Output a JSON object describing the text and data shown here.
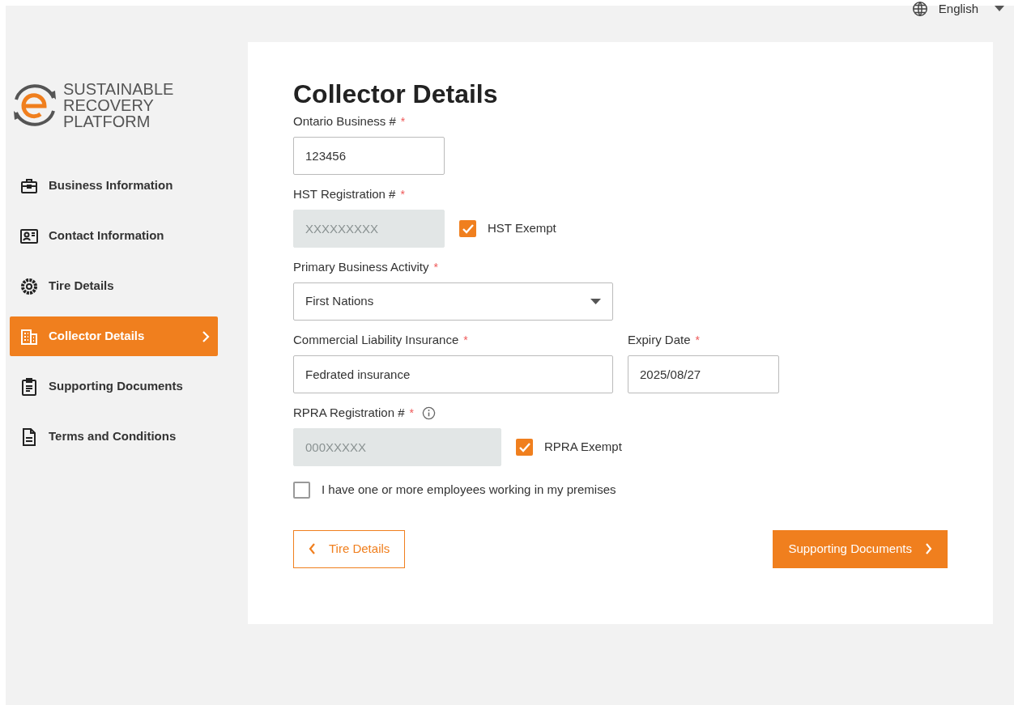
{
  "language": {
    "label": "English"
  },
  "logo": {
    "lines": [
      "SUSTAINABLE",
      "RECOVERY",
      "PLATFORM"
    ]
  },
  "sidebar": {
    "items": [
      {
        "label": "Business Information",
        "kind": "briefcase",
        "selected": false
      },
      {
        "label": "Contact Information",
        "kind": "contact",
        "selected": false
      },
      {
        "label": "Tire Details",
        "kind": "tire",
        "selected": false
      },
      {
        "label": "Collector Details",
        "kind": "building",
        "selected": true
      },
      {
        "label": "Supporting Documents",
        "kind": "clipboard",
        "selected": false
      },
      {
        "label": "Terms and Conditions",
        "kind": "document",
        "selected": false
      }
    ]
  },
  "form": {
    "title": "Collector Details",
    "rows": [
      {
        "fields": [
          {
            "kind": "text",
            "label": "Ontario Business #",
            "required_mark": "*",
            "value": "123456"
          }
        ]
      },
      {
        "fields": [
          {
            "kind": "text",
            "label": "HST Registration #",
            "required_mark": "*",
            "placeholder": "XXXXXXXXX",
            "disabled": true
          }
        ],
        "checkbox": {
          "label": "HST Exempt",
          "checked": true
        }
      },
      {
        "fields": [
          {
            "kind": "select",
            "label": "Primary Business Activity",
            "required_mark": "*",
            "value": "First Nations"
          }
        ]
      },
      {
        "fields": [
          {
            "kind": "text",
            "label": "Commercial Liability Insurance",
            "required_mark": "*",
            "value": "Fedrated insurance"
          },
          {
            "kind": "text",
            "label": "Expiry Date",
            "required_mark": "*",
            "value": "2025/08/27"
          }
        ]
      },
      {
        "fields": [
          {
            "kind": "text",
            "label": "RPRA Registration #",
            "required_mark": "*",
            "info": true,
            "placeholder": "000XXXXX",
            "disabled": true
          }
        ],
        "checkbox": {
          "label": "RPRA Exempt",
          "checked": true
        }
      }
    ],
    "employees_checkbox": {
      "label": "I have one or more employees working in my premises",
      "checked": false
    },
    "back_button": {
      "label": "Tire Details"
    },
    "next_button": {
      "label": "Supporting Documents"
    }
  }
}
